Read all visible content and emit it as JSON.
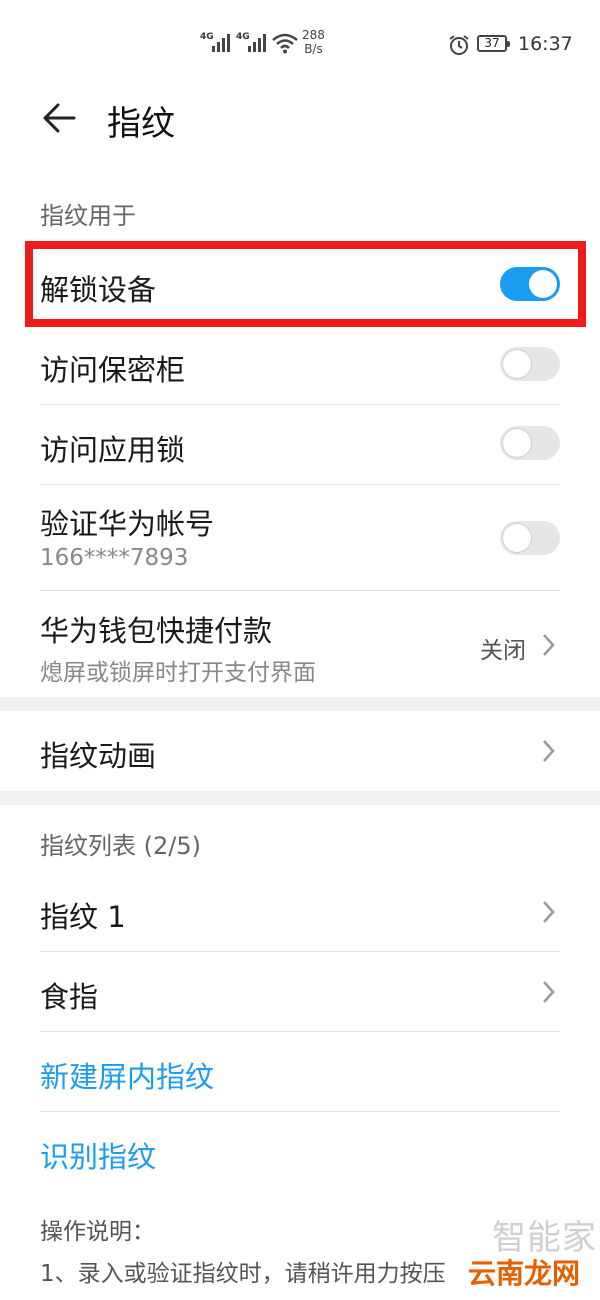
{
  "status_bar": {
    "net1": "4G",
    "net2": "4G",
    "speed_value": "288",
    "speed_unit": "B/s",
    "battery": "37",
    "time": "16:37"
  },
  "header": {
    "title": "指纹"
  },
  "section_usage": {
    "label": "指纹用于",
    "items": [
      {
        "title": "解锁设备",
        "toggle": true
      },
      {
        "title": "访问保密柜",
        "toggle": false
      },
      {
        "title": "访问应用锁",
        "toggle": false
      },
      {
        "title": "验证华为帐号",
        "subtitle": "166****7893",
        "toggle": false
      },
      {
        "title": "华为钱包快捷付款",
        "subtitle": "熄屏或锁屏时打开支付界面",
        "value": "关闭"
      }
    ]
  },
  "animation": {
    "title": "指纹动画"
  },
  "fingerprint_list": {
    "label": "指纹列表 (2/5)",
    "items": [
      {
        "title": "指纹 1"
      },
      {
        "title": "食指"
      }
    ],
    "add_link": "新建屏内指纹",
    "identify_link": "识别指纹"
  },
  "instructions": {
    "heading": "操作说明：",
    "line1": "1、录入或验证指纹时，请稍许用力按压"
  },
  "watermark": {
    "top": "智能家",
    "bottom": "云南龙网"
  },
  "colors": {
    "accent": "#1a9df0",
    "highlight": "#ee1b1b"
  }
}
